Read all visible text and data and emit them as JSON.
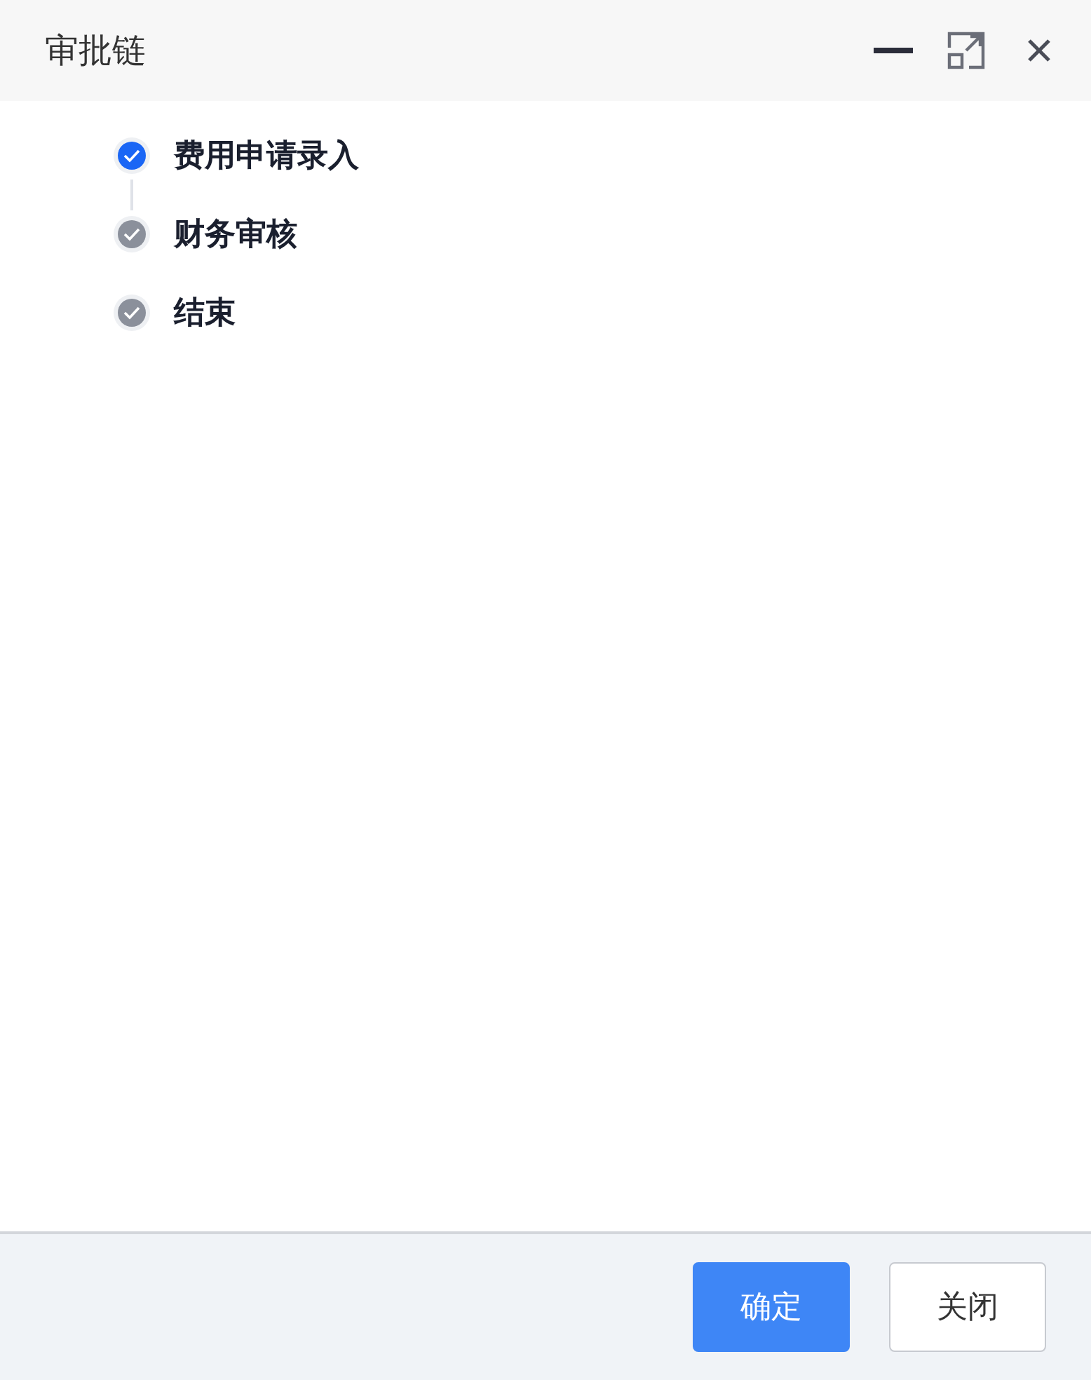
{
  "window": {
    "title": "审批链"
  },
  "steps": [
    {
      "label": "费用申请录入",
      "color": "#1a66f5",
      "connector": true
    },
    {
      "label": "财务审核",
      "color": "#8b909b",
      "connector": false
    },
    {
      "label": "结束",
      "color": "#8b909b",
      "connector": false
    }
  ],
  "buttons": [
    {
      "label": "确定",
      "kind": "primary"
    },
    {
      "label": "关闭",
      "kind": "secondary"
    }
  ]
}
